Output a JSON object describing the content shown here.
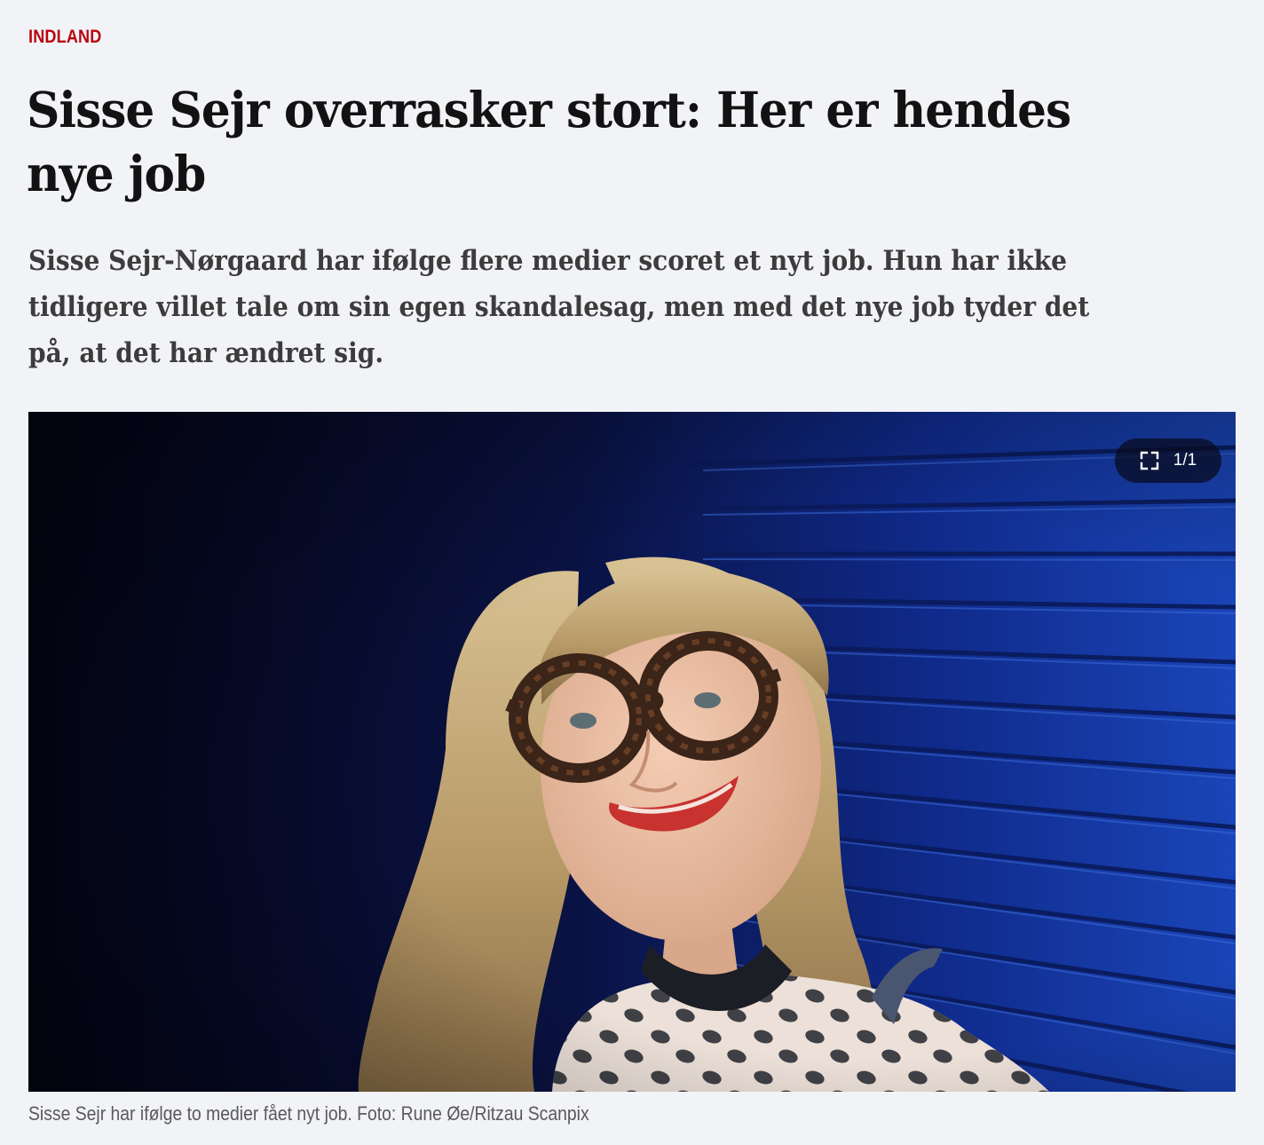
{
  "article": {
    "category": "INDLAND",
    "headline": "Sisse Sejr overrasker stort: Her er hendes nye job",
    "lead": "Sisse Sejr-Nørgaard har ifølge flere medier scoret et nyt job. Hun har ikke tidligere villet tale om sin egen skandalesag, men med det nye job tyder det på, at det har ændret sig.",
    "image": {
      "counter": "1/1",
      "expand_icon": "expand-icon",
      "caption": "Sisse Sejr har ifølge to medier fået nyt job. Foto: Rune Øe/Ritzau Scanpix"
    }
  },
  "colors": {
    "category": "#b8050f",
    "background": "#f2f3f7",
    "headline": "#121212",
    "lead": "#3c3c3c",
    "caption": "#5a5a5a"
  }
}
